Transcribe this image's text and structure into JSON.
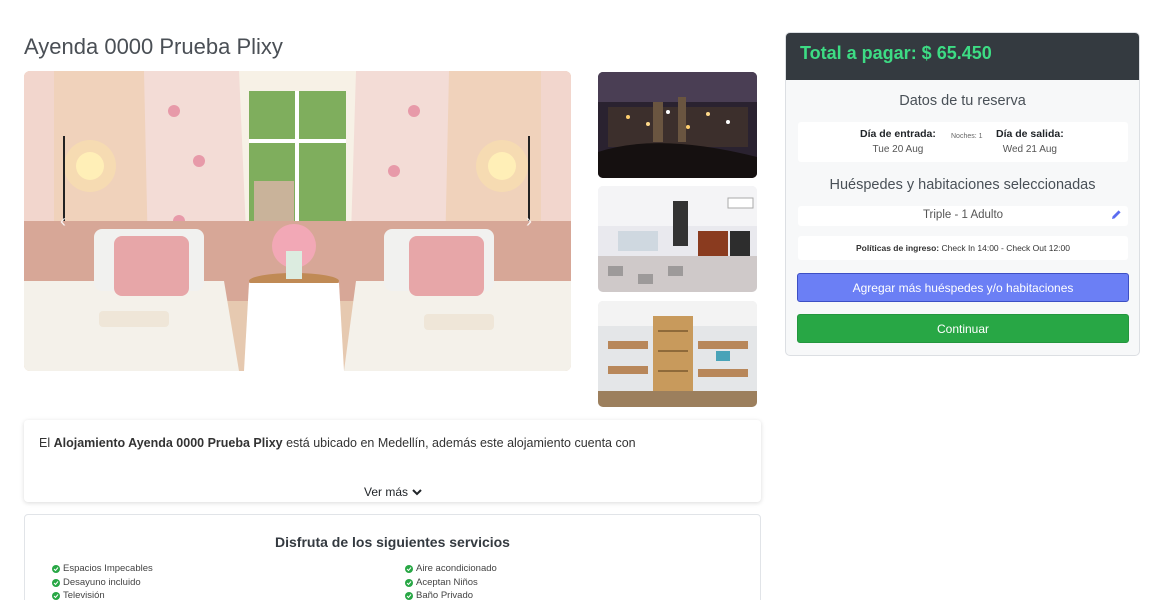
{
  "hotel": {
    "title": "Ayenda 0000 Prueba Plixy"
  },
  "gallery": {
    "main_alt": "Habitación con dos camas",
    "thumbs": [
      "Vista nocturna de la ciudad",
      "Habitación con cocina",
      "Habitación con camarotes"
    ]
  },
  "description": {
    "prefix": "El ",
    "name_bold": "Alojamiento Ayenda 0000 Prueba Plixy",
    "suffix": " está ubicado en Medellín, además este alojamiento cuenta con",
    "ver_mas": "Ver más"
  },
  "services": {
    "title": "Disfruta de los siguientes servicios",
    "left": [
      "Espacios Impecables",
      "Desayuno incluido",
      "Televisión"
    ],
    "right": [
      "Aire acondicionado",
      "Aceptan Niños",
      "Baño Privado"
    ]
  },
  "booking": {
    "total": "Total a pagar: $ 65.450",
    "reservation_title": "Datos de tu reserva",
    "checkin_label": "Día de entrada:",
    "checkin_value": "Tue 20 Aug",
    "nights": "Noches: 1",
    "checkout_label": "Día de salida:",
    "checkout_value": "Wed 21 Aug",
    "rooms_title": "Huéspedes y habitaciones seleccionadas",
    "room": "Triple - 1 Adulto",
    "policies_label": "Políticas de ingreso:",
    "policies_value": " Check In 14:00 - Check Out 12:00",
    "add_button": "Agregar más huéspedes y/o habitaciones",
    "continue_button": "Continuar"
  },
  "colors": {
    "total_text": "#3ddc84",
    "header_bg": "#343a40",
    "add_button": "#6b7ff5",
    "continue_button": "#28a745"
  }
}
